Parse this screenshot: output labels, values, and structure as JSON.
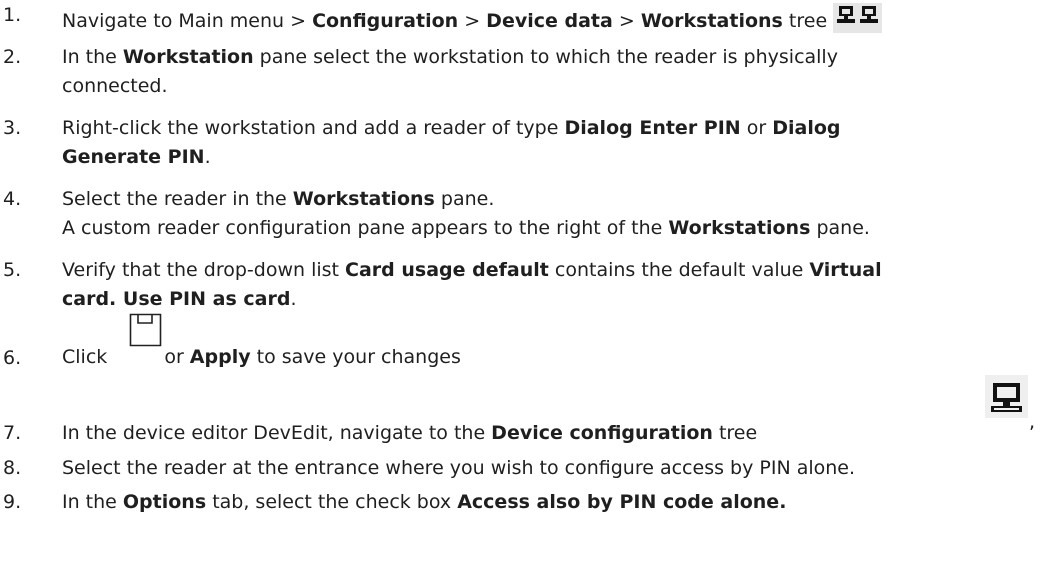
{
  "steps": [
    {
      "number": "1.",
      "parts": [
        "Navigate to Main menu > ",
        "Configuration",
        " > ",
        "Device data",
        " > ",
        "Workstations",
        " tree"
      ],
      "icon": "workstations-tree-icon"
    },
    {
      "number": "2.",
      "line1": [
        "In the ",
        "Workstation",
        " pane select the workstation to which the reader is physically"
      ],
      "line2": "connected."
    },
    {
      "number": "3.",
      "line1": [
        "Right-click the workstation and add a reader of type ",
        "Dialog Enter PIN",
        " or ",
        "Dialog"
      ],
      "line2": [
        "Generate PIN",
        "."
      ]
    },
    {
      "number": "4.",
      "line1": [
        "Select the reader in the ",
        "Workstations",
        " pane."
      ],
      "line2": [
        "A custom reader configuration pane appears to the right of the ",
        "Workstations",
        " pane."
      ]
    },
    {
      "number": "5.",
      "line1": [
        "Verify that the drop-down list ",
        "Card usage default",
        " contains the default value ",
        "Virtual"
      ],
      "line2": [
        "card. Use PIN as card",
        "."
      ]
    },
    {
      "number": "6.",
      "parts": [
        "Click",
        " or ",
        "Apply",
        " to save your changes"
      ],
      "icon": "save-icon"
    },
    {
      "number": "7.",
      "parts": [
        "In the device editor DevEdit, navigate to the ",
        "Device configuration",
        " tree"
      ],
      "icon": "device-configuration-icon",
      "trailing": ","
    },
    {
      "number": "8.",
      "text": "Select the reader at the entrance where you wish to configure access by PIN alone."
    },
    {
      "number": "9.",
      "parts": [
        "In the ",
        "Options",
        " tab, select the check box ",
        "Access also by PIN code alone."
      ]
    }
  ]
}
